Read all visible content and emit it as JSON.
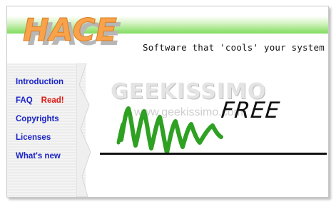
{
  "header": {
    "logo_text": "HACE",
    "tagline": "Software that 'cools' your system"
  },
  "sidebar": {
    "items": [
      {
        "label": "Introduction"
      },
      {
        "label": "FAQ",
        "badge": "Read!"
      },
      {
        "label": "Copyrights"
      },
      {
        "label": "Licenses"
      },
      {
        "label": "What's new"
      }
    ]
  },
  "main": {
    "watermark_title": "GEEKISSIMO",
    "watermark_url": "www.geekissimo.com",
    "free_text": "FREE"
  },
  "colors": {
    "top_green": "#7fdc5d",
    "logo_orange": "#f8a24b",
    "scribble_green": "#2ea022",
    "link_blue": "#1a23c8",
    "accent_red": "#e01a12"
  }
}
